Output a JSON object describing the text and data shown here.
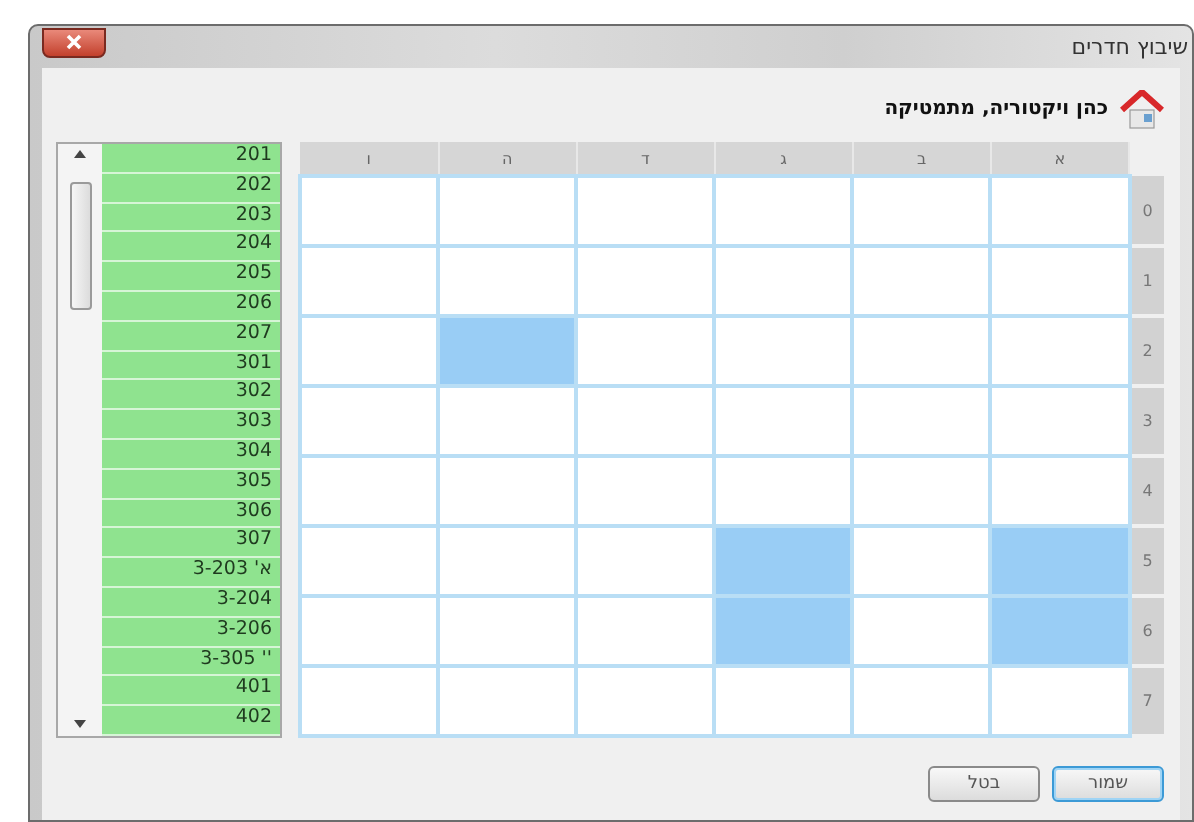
{
  "window": {
    "title": "שיבוץ חדרים"
  },
  "header": {
    "teacher": "כהן ויקטוריה, מתמטיקה"
  },
  "rooms": [
    "201",
    "202",
    "203",
    "204",
    "205",
    "206",
    "207",
    "301",
    "302",
    "303",
    "304",
    "305",
    "306",
    "307",
    "3-203 'א",
    "3-204",
    "3-206",
    "3-305 '' ",
    "401",
    "402"
  ],
  "grid": {
    "columns": [
      "ו",
      "ה",
      "ד",
      "ג",
      "ב",
      "א"
    ],
    "rows": [
      {
        "label": "0",
        "cells": [
          {
            "selected": false
          },
          {
            "selected": false
          },
          {
            "selected": false
          },
          {
            "selected": false
          },
          {
            "selected": false
          },
          {
            "selected": false
          }
        ]
      },
      {
        "label": "1",
        "cells": [
          {
            "selected": false
          },
          {
            "selected": false
          },
          {
            "selected": false
          },
          {
            "selected": false
          },
          {
            "selected": false
          },
          {
            "selected": false
          }
        ]
      },
      {
        "label": "2",
        "cells": [
          {
            "selected": false
          },
          {
            "selected": true
          },
          {
            "selected": false
          },
          {
            "selected": false
          },
          {
            "selected": false
          },
          {
            "selected": false
          }
        ]
      },
      {
        "label": "3",
        "cells": [
          {
            "selected": false
          },
          {
            "selected": false
          },
          {
            "selected": false
          },
          {
            "selected": false
          },
          {
            "selected": false
          },
          {
            "selected": false
          }
        ]
      },
      {
        "label": "4",
        "cells": [
          {
            "selected": false
          },
          {
            "selected": false
          },
          {
            "selected": false
          },
          {
            "selected": false
          },
          {
            "selected": false
          },
          {
            "selected": false
          }
        ]
      },
      {
        "label": "5",
        "cells": [
          {
            "selected": false
          },
          {
            "selected": false
          },
          {
            "selected": false
          },
          {
            "selected": true
          },
          {
            "selected": false
          },
          {
            "selected": true
          }
        ]
      },
      {
        "label": "6",
        "cells": [
          {
            "selected": false
          },
          {
            "selected": false
          },
          {
            "selected": false
          },
          {
            "selected": true
          },
          {
            "selected": false
          },
          {
            "selected": true
          }
        ]
      },
      {
        "label": "7",
        "cells": [
          {
            "selected": false
          },
          {
            "selected": false
          },
          {
            "selected": false
          },
          {
            "selected": false
          },
          {
            "selected": false
          },
          {
            "selected": false
          }
        ]
      }
    ]
  },
  "buttons": [
    {
      "label": "שמור",
      "kind": "default"
    },
    {
      "label": "בטל",
      "kind": "normal"
    }
  ]
}
